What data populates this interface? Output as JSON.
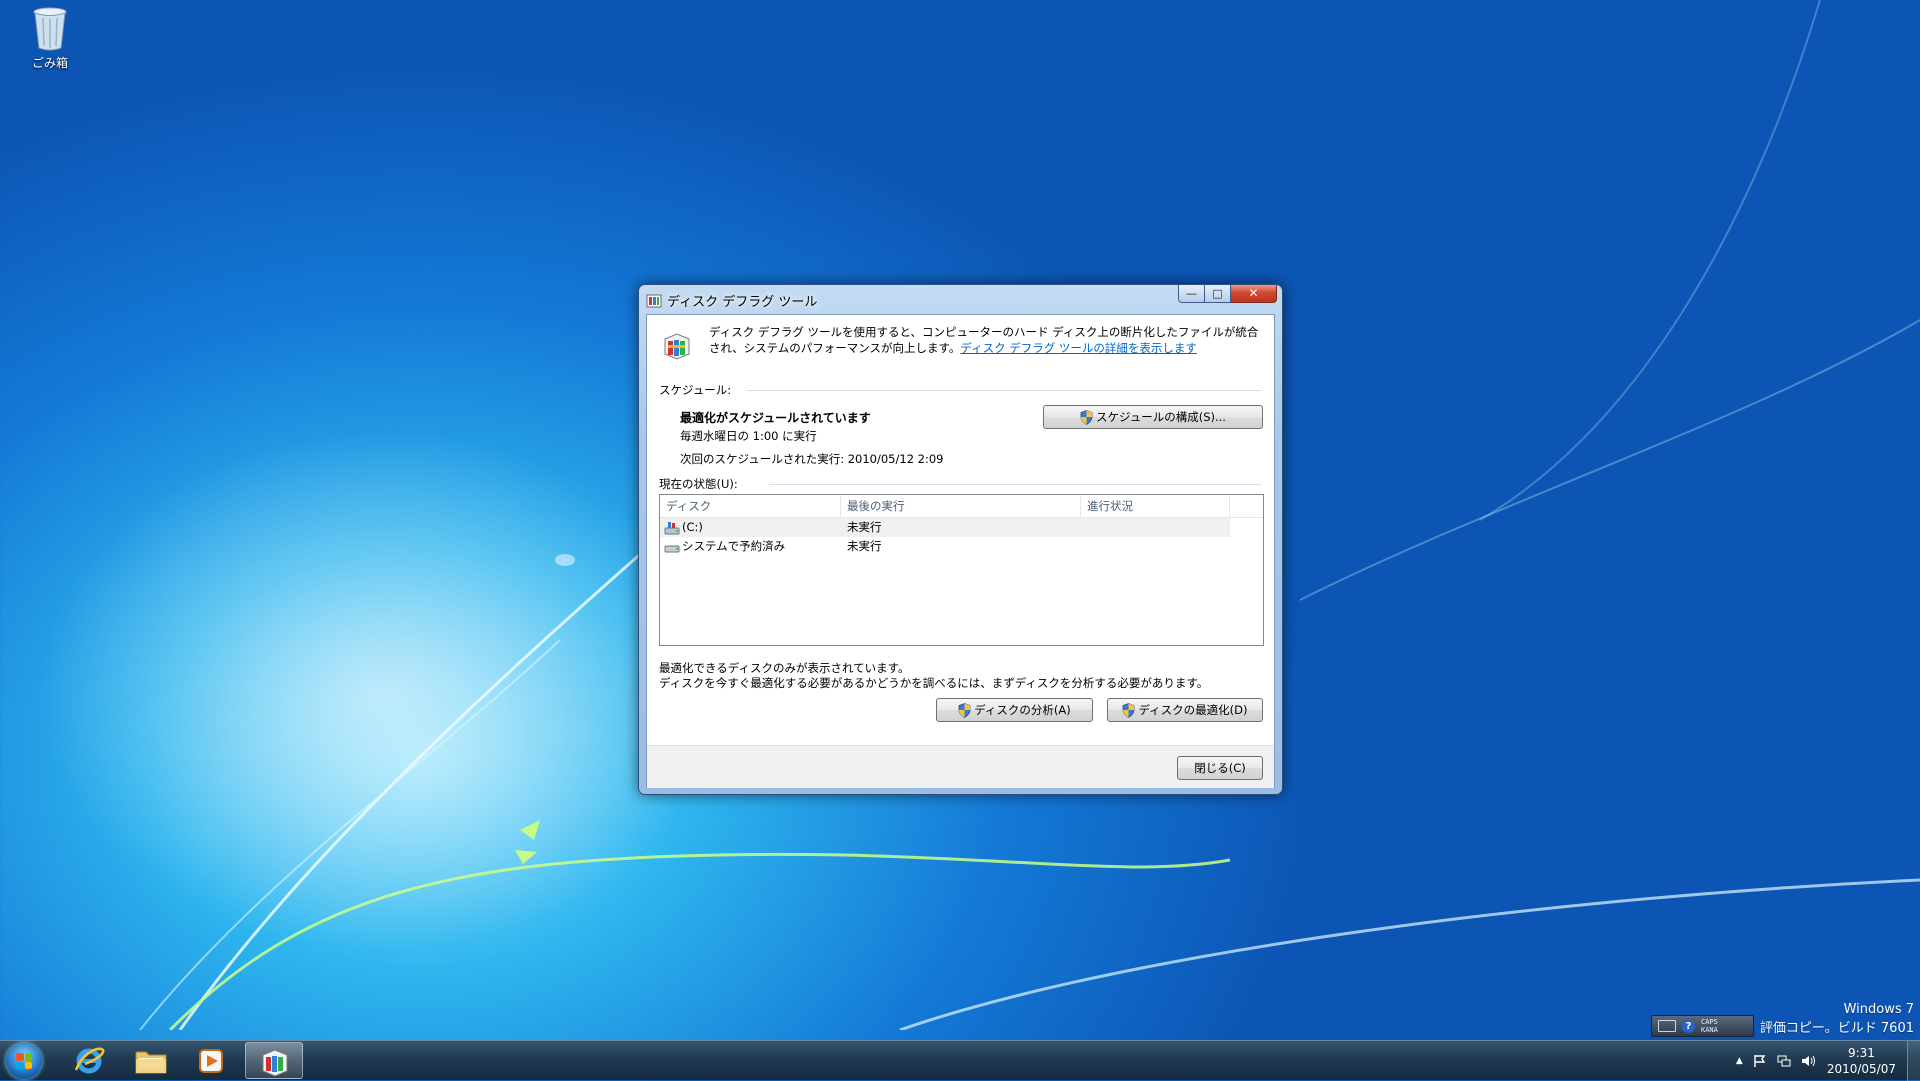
{
  "desktop": {
    "recycle_bin_label": "ごみ箱",
    "watermark_line1": "Windows 7",
    "watermark_line2": "評価コピー。ビルド 7601"
  },
  "language_bar": {
    "caps_label": "CAPS",
    "kana_label": "KANA",
    "help_label": "?"
  },
  "taskbar": {
    "pinned": [
      {
        "name": "internet-explorer",
        "icon": "ie-icon"
      },
      {
        "name": "windows-explorer",
        "icon": "folder-icon"
      },
      {
        "name": "media-player",
        "icon": "media-player-icon"
      },
      {
        "name": "disk-defragmenter",
        "icon": "defrag-icon",
        "active": true
      }
    ],
    "tray": {
      "show_hidden": "▲",
      "time": "9:31",
      "date": "2010/05/07"
    }
  },
  "window": {
    "title": "ディスク デフラグ ツール",
    "caption": {
      "minimize": "—",
      "maximize": "□",
      "close": "✕"
    },
    "intro_text": "ディスク デフラグ ツールを使用すると、コンピューターのハード ディスク上の断片化したファイルが統合され、システムのパフォーマンスが向上します。",
    "intro_link": "ディスク デフラグ ツールの詳細を表示します",
    "schedule": {
      "section_label": "スケジュール:",
      "status": "最適化がスケジュールされています",
      "frequency": "毎週水曜日の 1:00 に実行",
      "next_run": "次回のスケジュールされた実行: 2010/05/12 2:09",
      "configure_button": "スケジュールの構成(S)..."
    },
    "current_status": {
      "section_label": "現在の状態(U):",
      "columns": [
        "ディスク",
        "最後の実行",
        "進行状況"
      ],
      "rows": [
        {
          "disk": "(C:)",
          "last_run": "未実行",
          "progress": "",
          "icon": "drive-c-icon"
        },
        {
          "disk": "システムで予約済み",
          "last_run": "未実行",
          "progress": "",
          "icon": "drive-icon"
        }
      ]
    },
    "note_line1": "最適化できるディスクのみが表示されています。",
    "note_line2": "ディスクを今すぐ最適化する必要があるかどうかを調べるには、まずディスクを分析する必要があります。",
    "analyze_button": "ディスクの分析(A)",
    "defrag_button": "ディスクの最適化(D)",
    "close_button": "閉じる(C)"
  }
}
